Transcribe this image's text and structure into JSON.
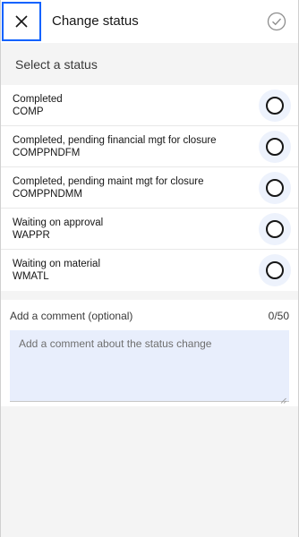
{
  "header": {
    "title": "Change status",
    "close_icon": "close-icon",
    "confirm_icon": "checkmark-circle-icon"
  },
  "section": {
    "label": "Select a status"
  },
  "statuses": [
    {
      "description": "Completed",
      "code": "COMP"
    },
    {
      "description": "Completed, pending financial mgt for closure",
      "code": "COMPPNDFM"
    },
    {
      "description": "Completed, pending maint mgt for closure",
      "code": "COMPPNDMM"
    },
    {
      "description": "Waiting on approval",
      "code": "WAPPR"
    },
    {
      "description": "Waiting on material",
      "code": "WMATL"
    }
  ],
  "comment": {
    "label": "Add a comment (optional)",
    "count": "0/50",
    "placeholder": "Add a comment about the status change",
    "value": ""
  },
  "colors": {
    "focus_border": "#0f62fe",
    "radio_halo": "#edf2fc",
    "textarea_bg": "#e8eefc"
  }
}
